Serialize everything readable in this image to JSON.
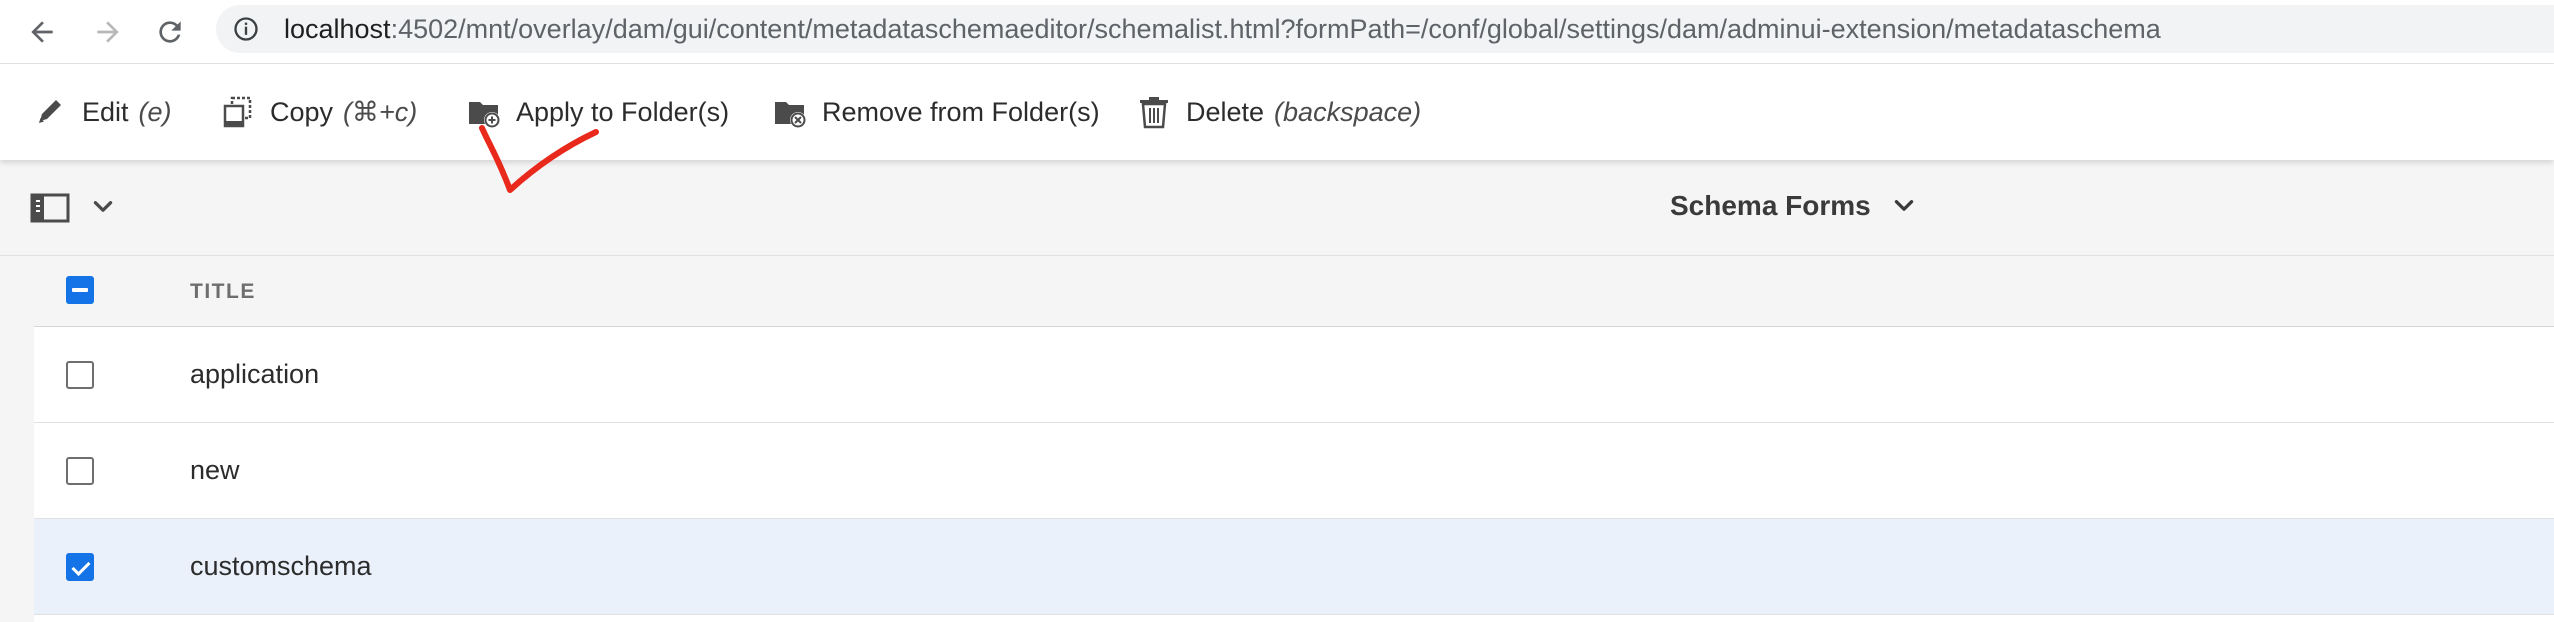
{
  "browser": {
    "url_host": "localhost",
    "url_rest": ":4502/mnt/overlay/dam/gui/content/metadataschemaeditor/schemalist.html?formPath=/conf/global/settings/dam/adminui-extension/metadataschema"
  },
  "actions": {
    "edit": {
      "label": "Edit",
      "shortcut": "(e)",
      "icon": "pencil-icon"
    },
    "copy": {
      "label": "Copy",
      "shortcut": "(⌘+c)",
      "icon": "copy-icon"
    },
    "apply": {
      "label": "Apply to Folder(s)",
      "icon": "folder-add-icon"
    },
    "remove": {
      "label": "Remove from Folder(s)",
      "icon": "folder-remove-icon"
    },
    "delete": {
      "label": "Delete",
      "shortcut": "(backspace)",
      "icon": "trash-icon"
    }
  },
  "toolbar": {
    "title": "Schema Forms"
  },
  "table": {
    "header_title": "TITLE",
    "rows": [
      {
        "title": "application",
        "selected": false
      },
      {
        "title": "new",
        "selected": false
      },
      {
        "title": "customschema",
        "selected": true
      }
    ]
  },
  "colors": {
    "accent": "#1473e6",
    "selected_row": "#eaf1fb",
    "annotation": "#e8291c"
  }
}
